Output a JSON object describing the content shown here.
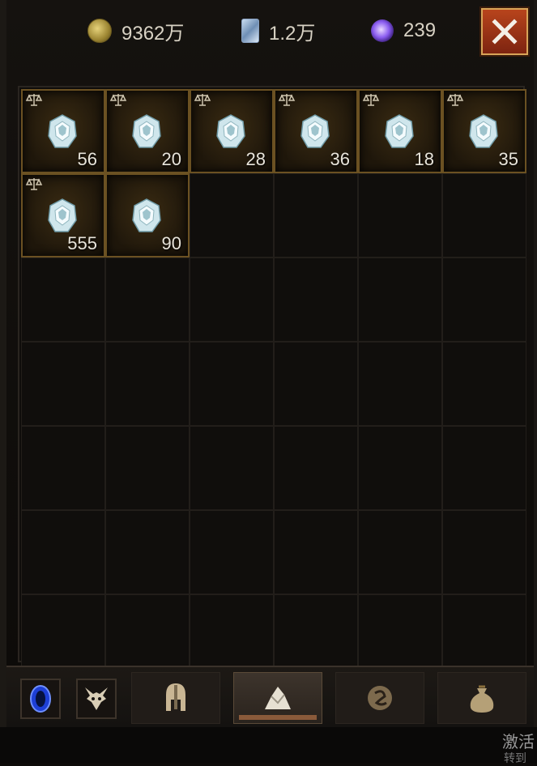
{
  "currency": {
    "gold": "9362万",
    "crystal": "1.2万",
    "orb": "239"
  },
  "inventory": {
    "items": [
      {
        "qty": "56",
        "tradeable": true
      },
      {
        "qty": "20",
        "tradeable": true
      },
      {
        "qty": "28",
        "tradeable": true
      },
      {
        "qty": "36",
        "tradeable": true
      },
      {
        "qty": "18",
        "tradeable": true
      },
      {
        "qty": "35",
        "tradeable": true
      },
      {
        "qty": "555",
        "tradeable": true
      },
      {
        "qty": "90",
        "tradeable": false
      }
    ]
  },
  "icons": {
    "close": "close-icon",
    "gem": "gem-icon",
    "tradeable": "scale-icon",
    "tabs": [
      "portal-icon",
      "demon-icon",
      "helmet-icon",
      "gem-pile-icon",
      "rune-icon",
      "sack-icon"
    ]
  },
  "overlay": {
    "activate": "激活",
    "activate_sub": "转到"
  },
  "colors": {
    "accent_gold": "#6b5122",
    "close_red": "#b8441c"
  }
}
